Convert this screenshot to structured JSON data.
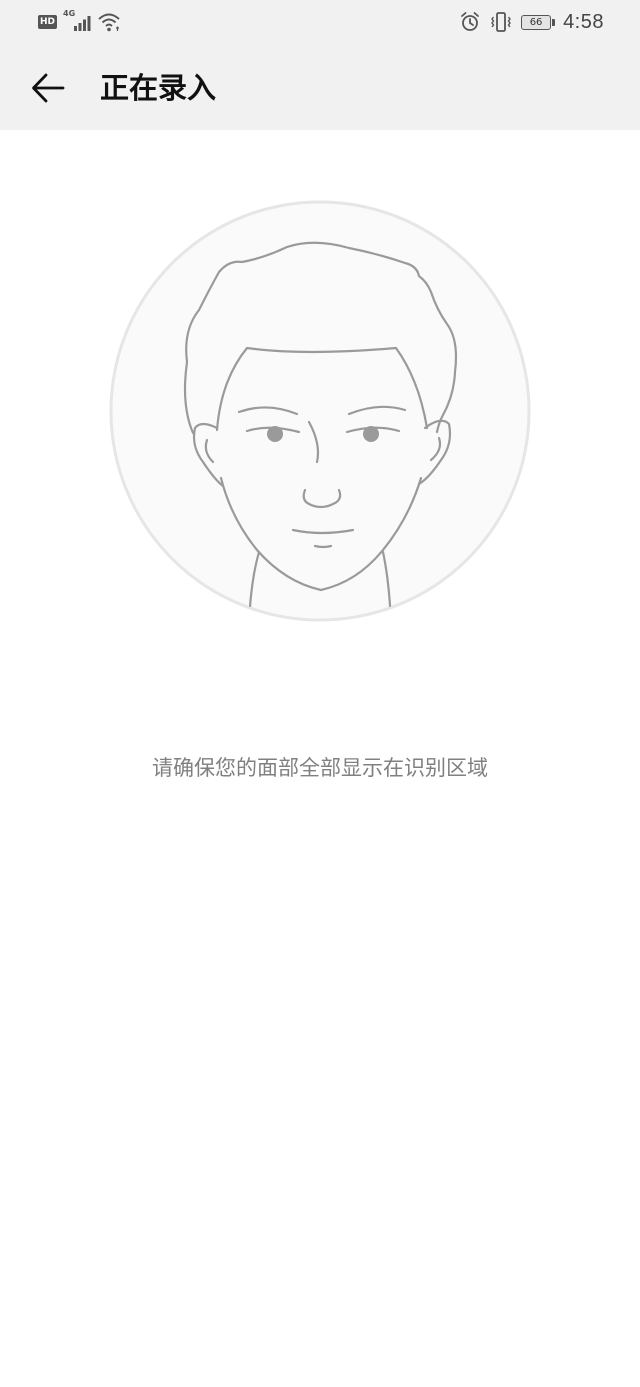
{
  "status_bar": {
    "network_badge": "HD",
    "signal_label": "4G",
    "battery_level": "66",
    "time": "4:58",
    "icons": [
      "hd-icon",
      "signal-icon",
      "wifi-icon",
      "alarm-icon",
      "vibrate-icon",
      "battery-icon"
    ]
  },
  "header": {
    "back_icon": "arrow-left-icon",
    "title": "正在录入"
  },
  "main": {
    "illustration": "face-outline-icon",
    "instruction": "请确保您的面部全部显示在识别区域"
  },
  "colors": {
    "bar_background": "#f1f1f1",
    "page_background": "#ffffff",
    "circle_fill": "#fafafa",
    "circle_stroke": "#e6e6e6",
    "face_stroke": "#9a9a9a",
    "instruction_text": "#808080",
    "title_text": "#111111"
  }
}
